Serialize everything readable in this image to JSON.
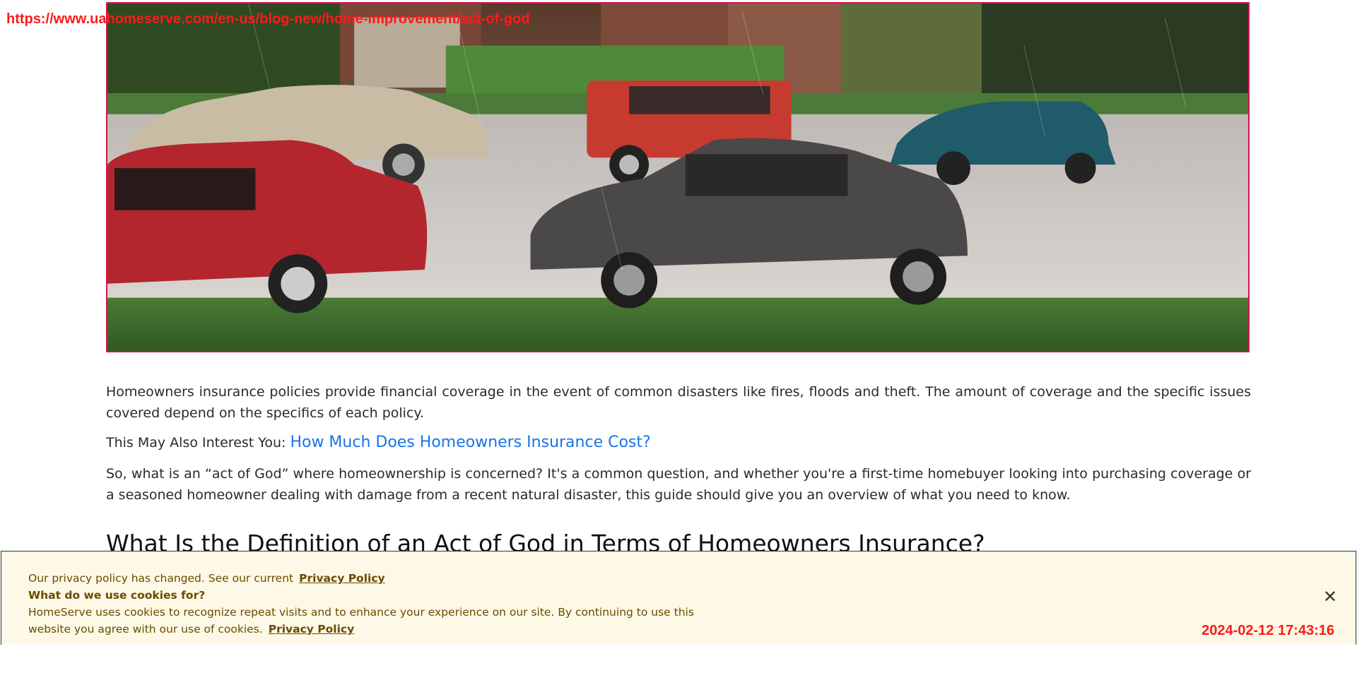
{
  "overlay": {
    "url": "https://www.uahomeserve.com/en-us/blog-new/home-improvement/act-of-god",
    "timestamp": "2024-02-12 17:43:16"
  },
  "hero_image": {
    "description_icon": "hail-storm-cars-photo"
  },
  "article": {
    "para1": "Homeowners insurance policies provide financial coverage in the event of common disasters like fires, floods and theft. The amount of coverage and the specific issues covered depend on the specifics of each policy.",
    "interest_prefix": "This May Also Interest You:",
    "interest_link": "How Much Does Homeowners Insurance Cost?",
    "para2": "So, what is an “act of God” where homeownership is concerned? It's a common question, and whether you're a first-time homebuyer looking into purchasing coverage or a seasoned homeowner dealing with damage from a recent natural disaster, this guide should give you an overview of what you need to know.",
    "heading": "What Is the Definition of an Act of God in Terms of Homeowners Insurance?"
  },
  "cookie_banner": {
    "line1": "Our privacy policy has changed. See our current",
    "link1": "Privacy Policy",
    "question": "What do we use cookies for?",
    "body": "HomeServe uses cookies to recognize repeat visits and to enhance your experience on our site. By continuing to use this website you agree with our use of cookies.",
    "link2": "Privacy Policy",
    "close_glyph": "✕"
  },
  "colors": {
    "link": "#1a73e8",
    "overlay_red": "#ff1a1a",
    "banner_bg": "#fdf9e6",
    "banner_text": "#6b4a00",
    "hero_border": "#d0154a"
  }
}
